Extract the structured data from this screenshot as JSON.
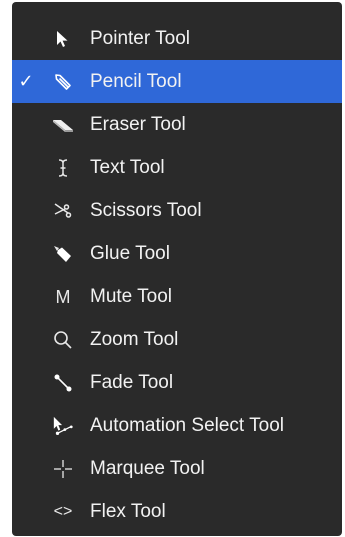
{
  "menu": {
    "selected_check": "✓",
    "items": [
      {
        "label": "Pointer Tool",
        "icon": "pointer-arrow-icon",
        "selected": false
      },
      {
        "label": "Pencil Tool",
        "icon": "pencil-icon",
        "selected": true
      },
      {
        "label": "Eraser Tool",
        "icon": "eraser-icon",
        "selected": false
      },
      {
        "label": "Text Tool",
        "icon": "text-cursor-icon",
        "selected": false
      },
      {
        "label": "Scissors Tool",
        "icon": "scissors-icon",
        "selected": false
      },
      {
        "label": "Glue Tool",
        "icon": "glue-icon",
        "selected": false
      },
      {
        "label": "Mute Tool",
        "icon": "mute-icon",
        "icon_text": "M",
        "selected": false
      },
      {
        "label": "Zoom Tool",
        "icon": "magnifier-icon",
        "selected": false
      },
      {
        "label": "Fade Tool",
        "icon": "fade-icon",
        "selected": false
      },
      {
        "label": "Automation Select Tool",
        "icon": "automation-select-icon",
        "selected": false
      },
      {
        "label": "Marquee Tool",
        "icon": "crosshair-icon",
        "selected": false
      },
      {
        "label": "Flex Tool",
        "icon": "flex-icon",
        "icon_text": "<>",
        "selected": false
      }
    ]
  },
  "colors": {
    "menu_background": "#2a2a2a",
    "selection": "#2f68d8",
    "text": "#f2f2f2"
  }
}
